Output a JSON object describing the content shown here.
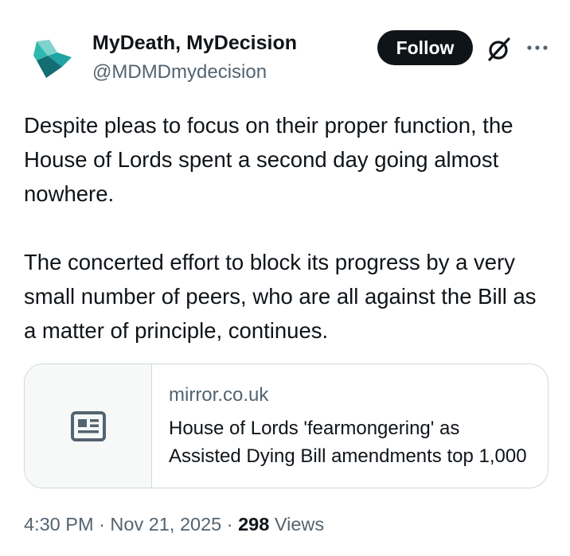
{
  "author": {
    "display_name": "MyDeath, MyDecision",
    "handle": "@MDMDmydecision",
    "avatar_icon": "mdmd-logo-icon"
  },
  "actions": {
    "follow_label": "Follow",
    "grok_icon": "grok-icon",
    "more_icon": "more-options-icon"
  },
  "tweet": {
    "paragraphs": [
      "Despite pleas to focus on their proper function, the House of Lords spent a second day going almost nowhere.",
      "The concerted effort to block its progress by a very small number of peers, who are all against the Bill as a matter of principle, continues."
    ]
  },
  "link_card": {
    "domain": "mirror.co.uk",
    "title": "House of Lords 'fearmongering' as Assisted Dying Bill amendments top 1,000",
    "thumbnail_icon": "article-icon"
  },
  "meta": {
    "time": "4:30 PM",
    "separator": "·",
    "date": "Nov 21, 2025",
    "views_count": "298",
    "views_label": "Views"
  },
  "colors": {
    "text_primary": "#0f1419",
    "text_secondary": "#536471",
    "border": "#cfd9de",
    "logo_teal": "#1fa3a3",
    "logo_dark_teal": "#136d73",
    "logo_light_teal": "#7fd3cc"
  }
}
